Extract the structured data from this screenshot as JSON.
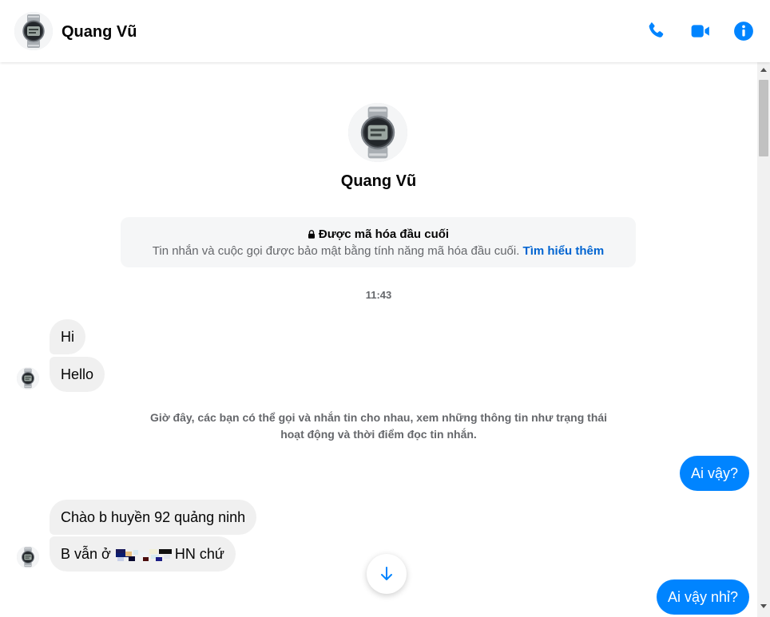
{
  "contact": {
    "name": "Quang Vũ",
    "avatar_icon": "watch-avatar"
  },
  "header": {
    "call_icon": "phone-icon",
    "video_icon": "video-camera-icon",
    "info_icon": "info-icon",
    "accent": "#0084ff"
  },
  "encryption": {
    "title": "Được mã hóa đầu cuối",
    "description": "Tin nhắn và cuộc gọi được bảo mật bằng tính năng mã hóa đầu cuối.",
    "link": "Tìm hiểu thêm"
  },
  "timestamp": "11:43",
  "messages": [
    {
      "from": "them",
      "text": "Hi"
    },
    {
      "from": "them",
      "text": "Hello"
    },
    {
      "from": "system",
      "text": "Giờ đây, các bạn có thể gọi và nhắn tin cho nhau, xem những thông tin như trạng thái hoạt động và thời điểm đọc tin nhắn."
    },
    {
      "from": "me",
      "text": "Ai vậy?"
    },
    {
      "from": "them",
      "text": "Chào b huyền 92 quảng ninh"
    },
    {
      "from": "them",
      "text_before": "B vẫn ở",
      "text_after": "HN chứ",
      "redacted": true
    },
    {
      "from": "me",
      "text": "Ai vậy nhỉ?"
    }
  ],
  "controls": {
    "scroll_down_icon": "arrow-down-icon"
  },
  "colors": {
    "outgoing_bubble": "#0084ff",
    "incoming_bubble": "#f0f0f0",
    "link": "#0064d1"
  }
}
